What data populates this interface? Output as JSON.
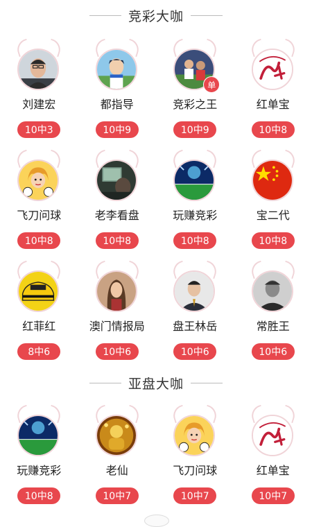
{
  "sections": [
    {
      "title": "竞彩大咖",
      "experts": [
        {
          "name": "刘建宏",
          "record": "10中3",
          "avatar": "man-glasses"
        },
        {
          "name": "都指导",
          "record": "10中9",
          "avatar": "anime-soccer"
        },
        {
          "name": "竞彩之王",
          "record": "10中9",
          "avatar": "soccer-players",
          "badge": "单"
        },
        {
          "name": "红单宝",
          "record": "10中8",
          "avatar": "red-hong-logo"
        },
        {
          "name": "飞刀问球",
          "record": "10中8",
          "avatar": "cartoon-girl-soccer"
        },
        {
          "name": "老李看盘",
          "record": "10中8",
          "avatar": "screen-person"
        },
        {
          "name": "玩赚竞彩",
          "record": "10中8",
          "avatar": "stadium"
        },
        {
          "name": "宝二代",
          "record": "10中8",
          "avatar": "china-flag"
        },
        {
          "name": "红菲红",
          "record": "8中6",
          "avatar": "yellow-car"
        },
        {
          "name": "澳门情报局",
          "record": "10中6",
          "avatar": "woman-portrait"
        },
        {
          "name": "盘王林岳",
          "record": "10中6",
          "avatar": "man-suit"
        },
        {
          "name": "常胜王",
          "record": "10中6",
          "avatar": "man-bw"
        }
      ]
    },
    {
      "title": "亚盘大咖",
      "experts": [
        {
          "name": "玩赚竞彩",
          "record": "10中8",
          "avatar": "stadium"
        },
        {
          "name": "老仙",
          "record": "10中7",
          "avatar": "gold-figure"
        },
        {
          "name": "飞刀问球",
          "record": "10中7",
          "avatar": "cartoon-girl-soccer"
        },
        {
          "name": "红单宝",
          "record": "10中7",
          "avatar": "red-hong-logo"
        }
      ]
    }
  ],
  "colors": {
    "accent": "#e8474d",
    "avatarBorder": "#f0d4d8"
  }
}
